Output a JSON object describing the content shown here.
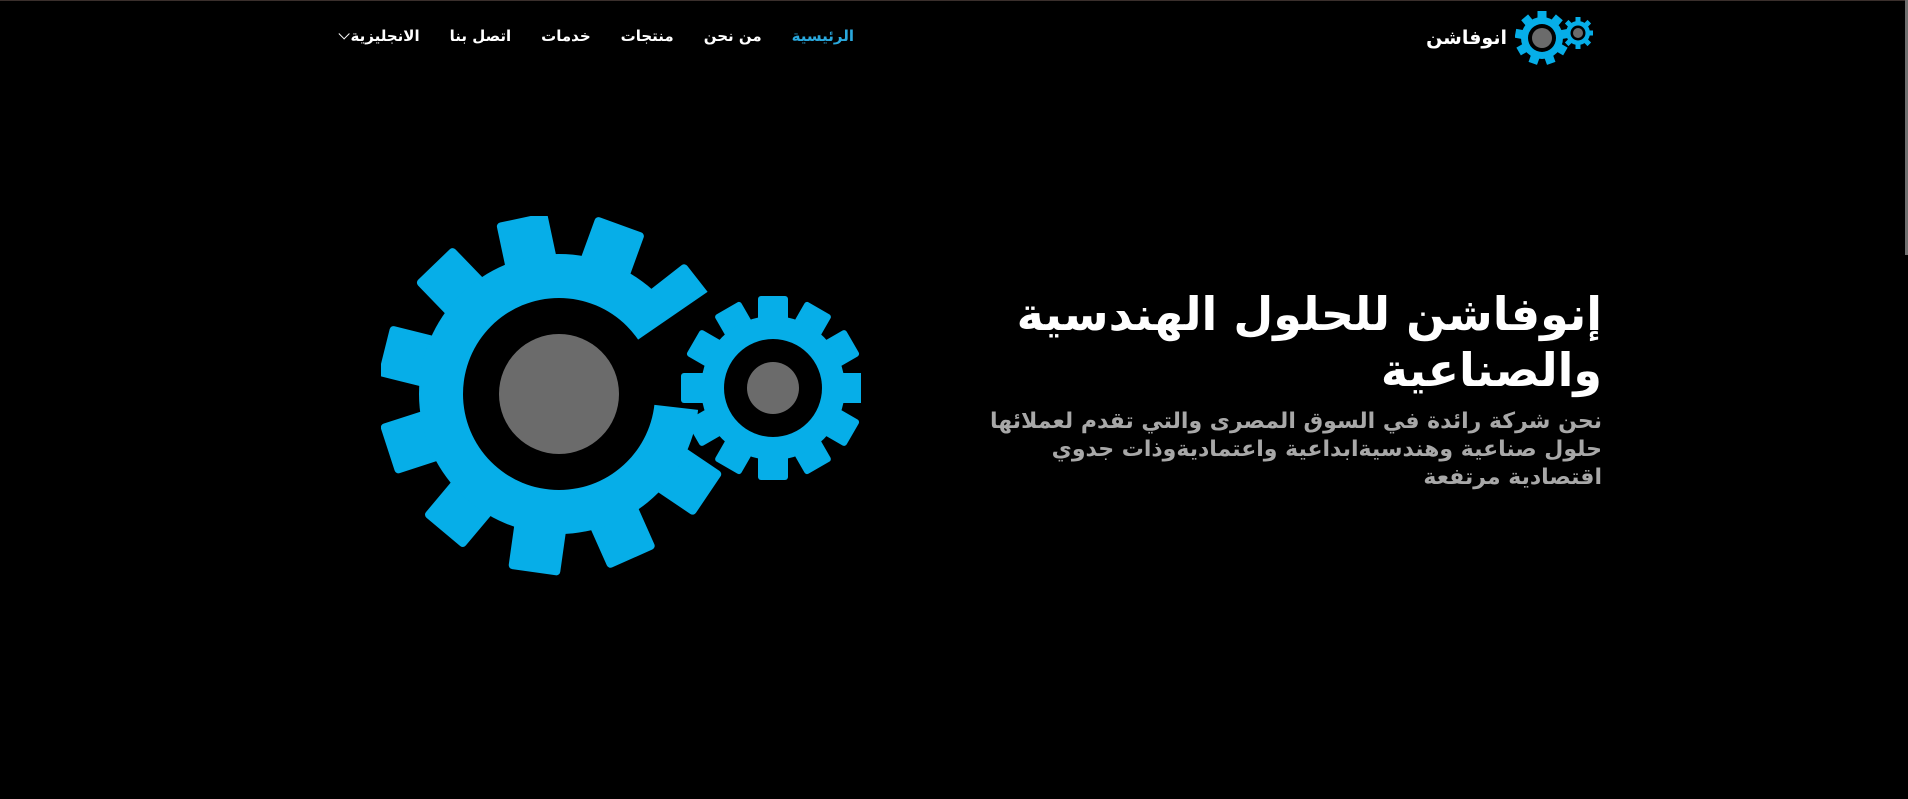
{
  "brand": {
    "name": "انوفاشن",
    "logo_icon": "gears-icon"
  },
  "nav": {
    "items": [
      {
        "label": "الرئيسية",
        "active": true
      },
      {
        "label": "من نحن",
        "active": false
      },
      {
        "label": "منتجات",
        "active": false
      },
      {
        "label": "خدمات",
        "active": false
      },
      {
        "label": "اتصل بنا",
        "active": false
      },
      {
        "label": "الانجليزية",
        "active": false,
        "dropdown_icon": "chevron-down-icon"
      }
    ]
  },
  "hero": {
    "title": "إنوفاشن للحلول الهندسية والصناعية",
    "subtitle": "نحن شركة رائدة في السوق المصرى والتي تقدم لعملائها حلول صناعية وهندسيةابداعية واعتماديةوذات جدوي اقتصادية مرتفعة",
    "illustration_icon": "gears-illustration"
  },
  "colors": {
    "background": "#000000",
    "accent": "#06aee8",
    "gear_hub": "#6b6b6b",
    "nav_active": "#2aa8dd",
    "subtitle": "#a8a8a8"
  }
}
